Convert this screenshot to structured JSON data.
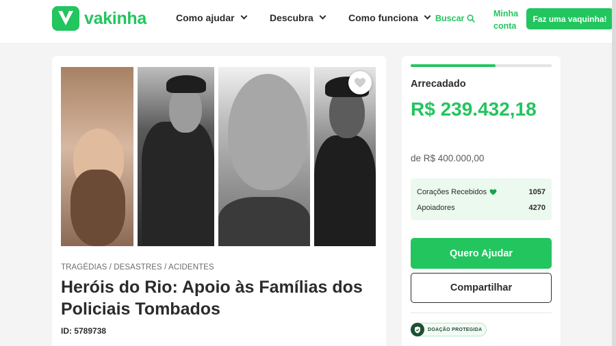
{
  "header": {
    "logo_text": "vakinha",
    "nav": [
      {
        "label": "Como ajudar"
      },
      {
        "label": "Descubra"
      },
      {
        "label": "Como funciona"
      }
    ],
    "search_label": "Buscar",
    "account_line1": "Minha",
    "account_line2": "conta",
    "cta_label": "Faz uma vaquinha!"
  },
  "campaign": {
    "category": "TRAGÉDIAS / DESASTRES / ACIDENTES",
    "title": "Heróis do Rio: Apoio às Famílias dos Policiais Tombados",
    "id_text": "ID: 5789738"
  },
  "donation": {
    "progress_fraction": 0.6,
    "raised_label": "Arrecadado",
    "raised_amount": "R$ 239.432,18",
    "goal_text": "de R$ 400.000,00",
    "stats": {
      "hearts_label": "Corações Recebidos",
      "hearts_value": "1057",
      "supporters_label": "Apoiadores",
      "supporters_value": "4270"
    },
    "help_button": "Quero Ajudar",
    "share_button": "Compartilhar",
    "protected_badge": "DOAÇÃO PROTEGIDA"
  },
  "colors": {
    "brand": "#22c55e",
    "text": "#2b2b2b",
    "background": "#f4f4f4"
  },
  "icons": [
    "logo-mark-icon",
    "chevron-down-icon",
    "search-icon",
    "heart-icon",
    "shield-icon"
  ]
}
